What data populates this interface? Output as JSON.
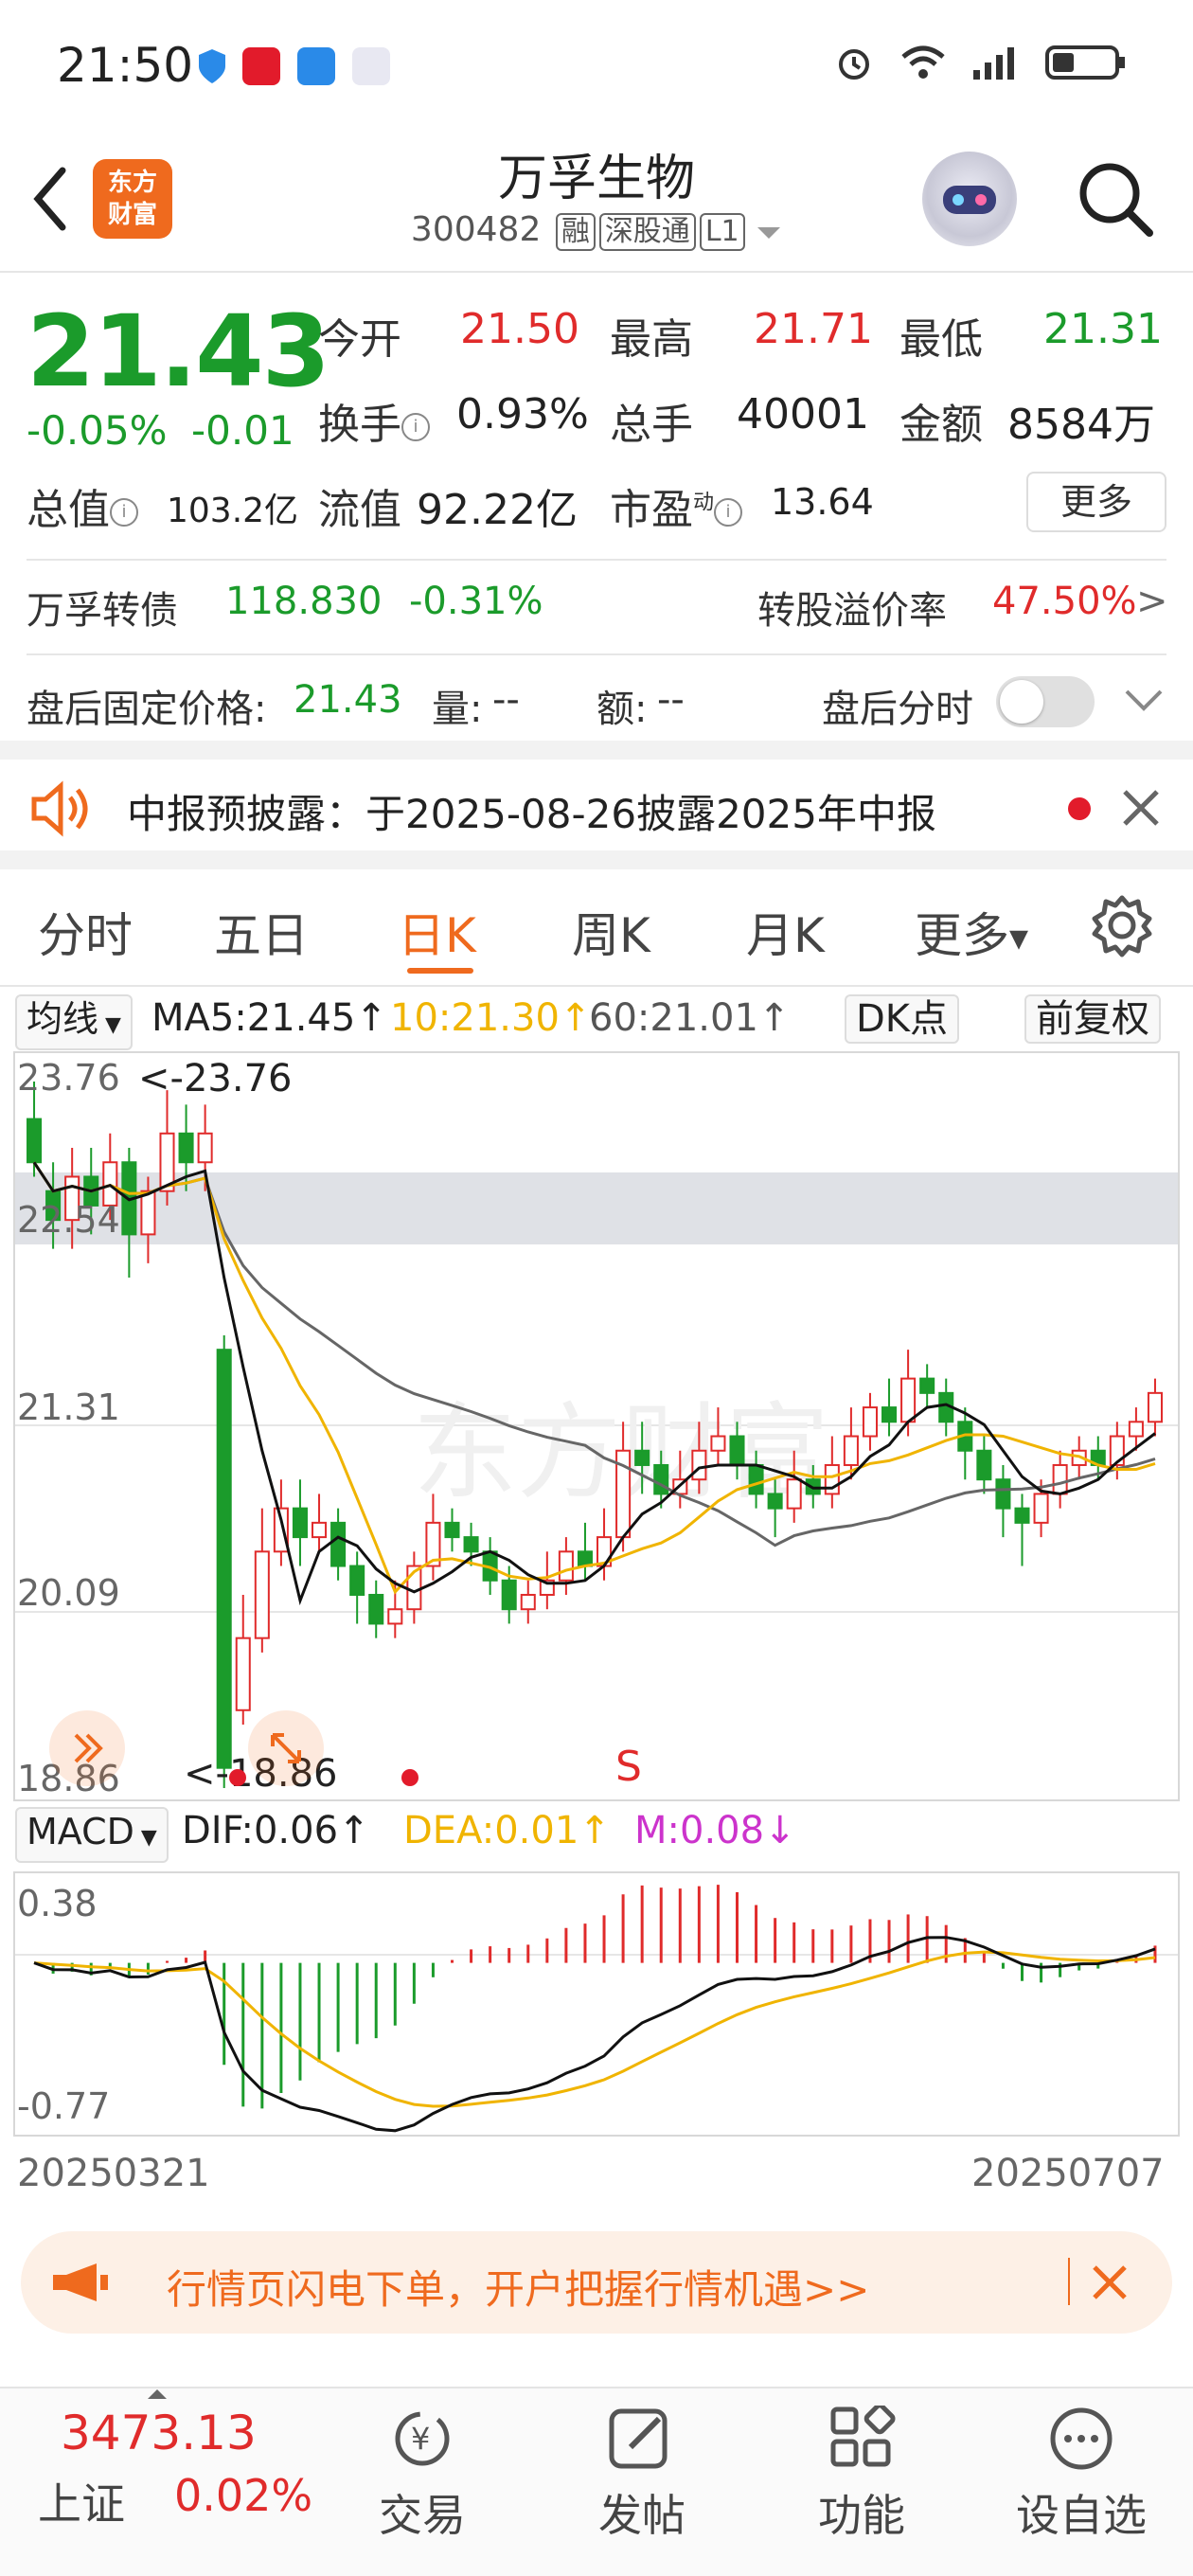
{
  "status_bar": {
    "time": "21:50"
  },
  "header": {
    "logo_text_1": "东方",
    "logo_text_2": "财富",
    "title": "万孚生物",
    "code": "300482",
    "tags": [
      "融",
      "深股通",
      "L1"
    ]
  },
  "quote": {
    "price": "21.43",
    "change_pct": "-0.05%",
    "change": "-0.01",
    "open_label": "今开",
    "open": "21.50",
    "high_label": "最高",
    "high": "21.71",
    "low_label": "最低",
    "low": "21.31",
    "turnover_label": "换手",
    "turnover": "0.93%",
    "volume_label": "总手",
    "volume": "40001",
    "amount_label": "金额",
    "amount": "8584万",
    "mktcap_label": "总值",
    "mktcap": "103.2亿",
    "float_label": "流值",
    "float": "92.22亿",
    "pe_label": "市盈",
    "pe_sup": "动",
    "pe": "13.64",
    "more_button": "更多"
  },
  "bond": {
    "name": "万孚转债",
    "price": "118.830",
    "pct": "-0.31%",
    "premium_label": "转股溢价率",
    "premium": "47.50%",
    "arrow": ">"
  },
  "after_hours": {
    "price_label": "盘后固定价格:",
    "price": "21.43",
    "vol_label": "量:",
    "vol": "--",
    "amt_label": "额:",
    "amt": "--",
    "toggle_label": "盘后分时"
  },
  "notice": {
    "text": "中报预披露：于2025-08-26披露2025年中报"
  },
  "tabs": [
    "分时",
    "五日",
    "日K",
    "周K",
    "月K",
    "更多"
  ],
  "ma_row": {
    "selector": "均线",
    "ma5": "MA5:21.45↑",
    "ma10": "10:21.30↑",
    "ma60": "60:21.01↑",
    "dk": "DK点",
    "adjust": "前复权"
  },
  "kline": {
    "y_labels": [
      "23.76",
      "22.54",
      "21.31",
      "20.09",
      "18.86"
    ],
    "max_marker": "<-23.76",
    "min_marker": "<-18.86",
    "s_marker": "S",
    "watermark": "东方财富"
  },
  "macd_row": {
    "selector": "MACD",
    "dif": "DIF:0.06↑",
    "dea": "DEA:0.01↑",
    "m": "M:0.08↓",
    "y_top": "0.38",
    "y_bottom": "-0.77"
  },
  "dates": {
    "start": "20250321",
    "end": "20250707"
  },
  "ad": {
    "text": "行情页闪电下单，开户把握行情机遇>>"
  },
  "bottom_nav": {
    "index_value": "3473.13",
    "index_name": "上证",
    "index_pct": "0.02%",
    "items": [
      "交易",
      "发帖",
      "功能",
      "设自选"
    ]
  },
  "colors": {
    "up": "#e02b2b",
    "down": "#1b9b2b",
    "accent": "#ef6a1e"
  },
  "chart_data": {
    "type": "candlestick",
    "title": "",
    "date_range": [
      "20250321",
      "20250707"
    ],
    "ylim": [
      18.86,
      23.76
    ],
    "notable": {
      "max": 23.76,
      "min": 18.86
    },
    "candles": [
      {
        "o": 23.5,
        "c": 23.2,
        "h": 23.76,
        "l": 23.1
      },
      {
        "o": 23.0,
        "c": 22.8,
        "h": 23.2,
        "l": 22.6
      },
      {
        "o": 22.8,
        "c": 23.1,
        "h": 23.3,
        "l": 22.6
      },
      {
        "o": 23.1,
        "c": 22.9,
        "h": 23.3,
        "l": 22.7
      },
      {
        "o": 22.9,
        "c": 23.2,
        "h": 23.4,
        "l": 22.8
      },
      {
        "o": 23.2,
        "c": 22.7,
        "h": 23.3,
        "l": 22.4
      },
      {
        "o": 22.7,
        "c": 23.0,
        "h": 23.1,
        "l": 22.5
      },
      {
        "o": 23.0,
        "c": 23.4,
        "h": 23.7,
        "l": 22.9
      },
      {
        "o": 23.4,
        "c": 23.2,
        "h": 23.6,
        "l": 23.0
      },
      {
        "o": 23.2,
        "c": 23.4,
        "h": 23.6,
        "l": 23.0
      },
      {
        "o": 21.9,
        "c": 19.0,
        "h": 22.0,
        "l": 18.86
      },
      {
        "o": 19.4,
        "c": 19.9,
        "h": 20.2,
        "l": 19.3
      },
      {
        "o": 19.9,
        "c": 20.5,
        "h": 20.8,
        "l": 19.8
      },
      {
        "o": 20.5,
        "c": 20.8,
        "h": 21.0,
        "l": 20.4
      },
      {
        "o": 20.8,
        "c": 20.6,
        "h": 21.0,
        "l": 20.4
      },
      {
        "o": 20.6,
        "c": 20.7,
        "h": 20.9,
        "l": 20.5
      },
      {
        "o": 20.7,
        "c": 20.4,
        "h": 20.8,
        "l": 20.3
      },
      {
        "o": 20.4,
        "c": 20.2,
        "h": 20.5,
        "l": 20.0
      },
      {
        "o": 20.2,
        "c": 20.0,
        "h": 20.3,
        "l": 19.9
      },
      {
        "o": 20.0,
        "c": 20.1,
        "h": 20.3,
        "l": 19.9
      },
      {
        "o": 20.1,
        "c": 20.4,
        "h": 20.5,
        "l": 20.0
      },
      {
        "o": 20.4,
        "c": 20.7,
        "h": 20.9,
        "l": 20.3
      },
      {
        "o": 20.7,
        "c": 20.6,
        "h": 20.8,
        "l": 20.5
      },
      {
        "o": 20.6,
        "c": 20.5,
        "h": 20.7,
        "l": 20.4
      },
      {
        "o": 20.5,
        "c": 20.3,
        "h": 20.6,
        "l": 20.2
      },
      {
        "o": 20.3,
        "c": 20.1,
        "h": 20.4,
        "l": 20.0
      },
      {
        "o": 20.1,
        "c": 20.2,
        "h": 20.3,
        "l": 20.0
      },
      {
        "o": 20.2,
        "c": 20.3,
        "h": 20.5,
        "l": 20.1
      },
      {
        "o": 20.3,
        "c": 20.5,
        "h": 20.6,
        "l": 20.2
      },
      {
        "o": 20.5,
        "c": 20.4,
        "h": 20.7,
        "l": 20.3
      },
      {
        "o": 20.4,
        "c": 20.6,
        "h": 20.8,
        "l": 20.3
      },
      {
        "o": 20.6,
        "c": 21.2,
        "h": 21.4,
        "l": 20.5
      },
      {
        "o": 21.2,
        "c": 21.1,
        "h": 21.4,
        "l": 20.9
      },
      {
        "o": 21.1,
        "c": 20.9,
        "h": 21.2,
        "l": 20.8
      },
      {
        "o": 20.9,
        "c": 21.0,
        "h": 21.2,
        "l": 20.8
      },
      {
        "o": 21.0,
        "c": 21.2,
        "h": 21.4,
        "l": 20.9
      },
      {
        "o": 21.2,
        "c": 21.3,
        "h": 21.5,
        "l": 21.1
      },
      {
        "o": 21.3,
        "c": 21.1,
        "h": 21.4,
        "l": 21.0
      },
      {
        "o": 21.1,
        "c": 20.9,
        "h": 21.2,
        "l": 20.8
      },
      {
        "o": 20.9,
        "c": 20.8,
        "h": 21.0,
        "l": 20.6
      },
      {
        "o": 20.8,
        "c": 21.0,
        "h": 21.2,
        "l": 20.7
      },
      {
        "o": 21.0,
        "c": 20.9,
        "h": 21.1,
        "l": 20.8
      },
      {
        "o": 20.9,
        "c": 21.1,
        "h": 21.3,
        "l": 20.8
      },
      {
        "o": 21.1,
        "c": 21.3,
        "h": 21.5,
        "l": 21.0
      },
      {
        "o": 21.3,
        "c": 21.5,
        "h": 21.6,
        "l": 21.2
      },
      {
        "o": 21.5,
        "c": 21.4,
        "h": 21.7,
        "l": 21.3
      },
      {
        "o": 21.4,
        "c": 21.7,
        "h": 21.9,
        "l": 21.3
      },
      {
        "o": 21.7,
        "c": 21.6,
        "h": 21.8,
        "l": 21.5
      },
      {
        "o": 21.6,
        "c": 21.4,
        "h": 21.7,
        "l": 21.3
      },
      {
        "o": 21.4,
        "c": 21.2,
        "h": 21.5,
        "l": 21.0
      },
      {
        "o": 21.2,
        "c": 21.0,
        "h": 21.3,
        "l": 20.9
      },
      {
        "o": 21.0,
        "c": 20.8,
        "h": 21.1,
        "l": 20.6
      },
      {
        "o": 20.8,
        "c": 20.7,
        "h": 20.9,
        "l": 20.4
      },
      {
        "o": 20.7,
        "c": 20.9,
        "h": 21.0,
        "l": 20.6
      },
      {
        "o": 20.9,
        "c": 21.1,
        "h": 21.2,
        "l": 20.8
      },
      {
        "o": 21.1,
        "c": 21.2,
        "h": 21.3,
        "l": 21.0
      },
      {
        "o": 21.2,
        "c": 21.1,
        "h": 21.3,
        "l": 21.0
      },
      {
        "o": 21.1,
        "c": 21.3,
        "h": 21.4,
        "l": 21.0
      },
      {
        "o": 21.3,
        "c": 21.4,
        "h": 21.5,
        "l": 21.2
      },
      {
        "o": 21.4,
        "c": 21.6,
        "h": 21.7,
        "l": 21.3
      }
    ]
  }
}
